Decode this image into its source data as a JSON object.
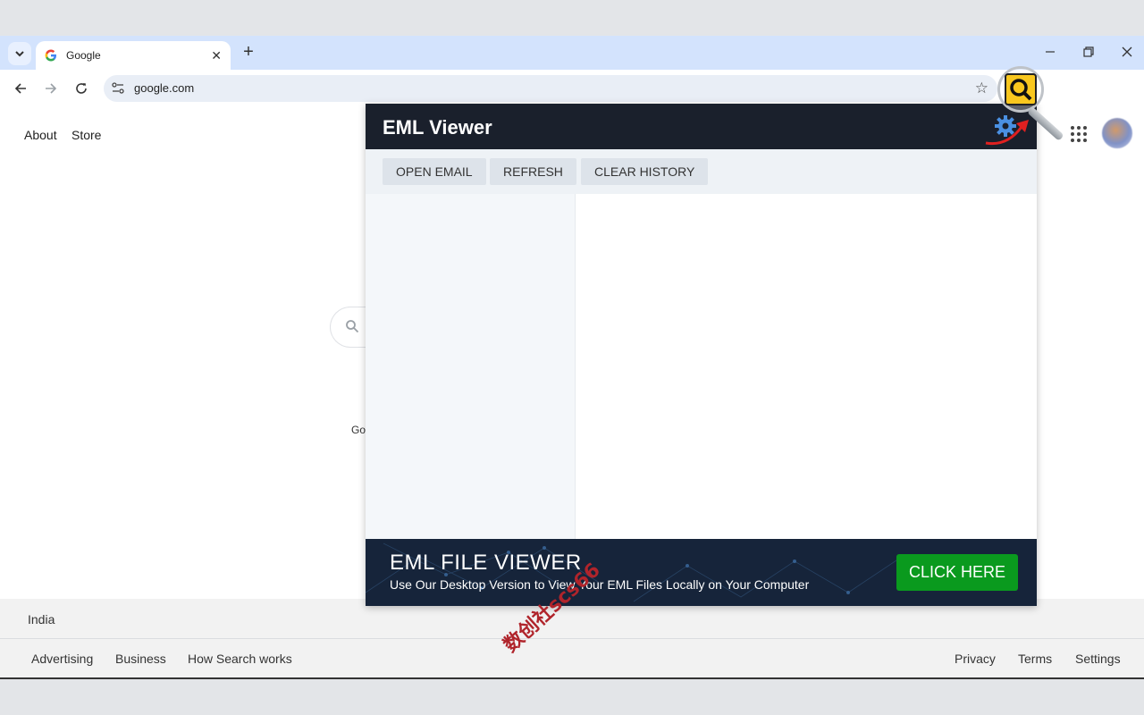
{
  "browser": {
    "tab_title": "Google",
    "url": "google.com"
  },
  "page": {
    "top_links": [
      "About",
      "Store"
    ],
    "search_fragment": "Go",
    "footer": {
      "country": "India",
      "left_links": [
        "Advertising",
        "Business",
        "How Search works"
      ],
      "right_links": [
        "Privacy",
        "Terms",
        "Settings"
      ]
    }
  },
  "popup": {
    "title": "EML Viewer",
    "buttons": [
      "OPEN EMAIL",
      "REFRESH",
      "CLEAR HISTORY"
    ],
    "banner": {
      "title": "EML FILE VIEWER",
      "subtitle": "Use Our Desktop Version to View Your EML Files Locally on Your Computer",
      "cta": "CLICK HERE"
    }
  },
  "watermark": "数创社scs66",
  "colors": {
    "popup_header": "#1a202c",
    "cta_green": "#0a9a1e",
    "extension_yellow": "#f9c71e"
  }
}
